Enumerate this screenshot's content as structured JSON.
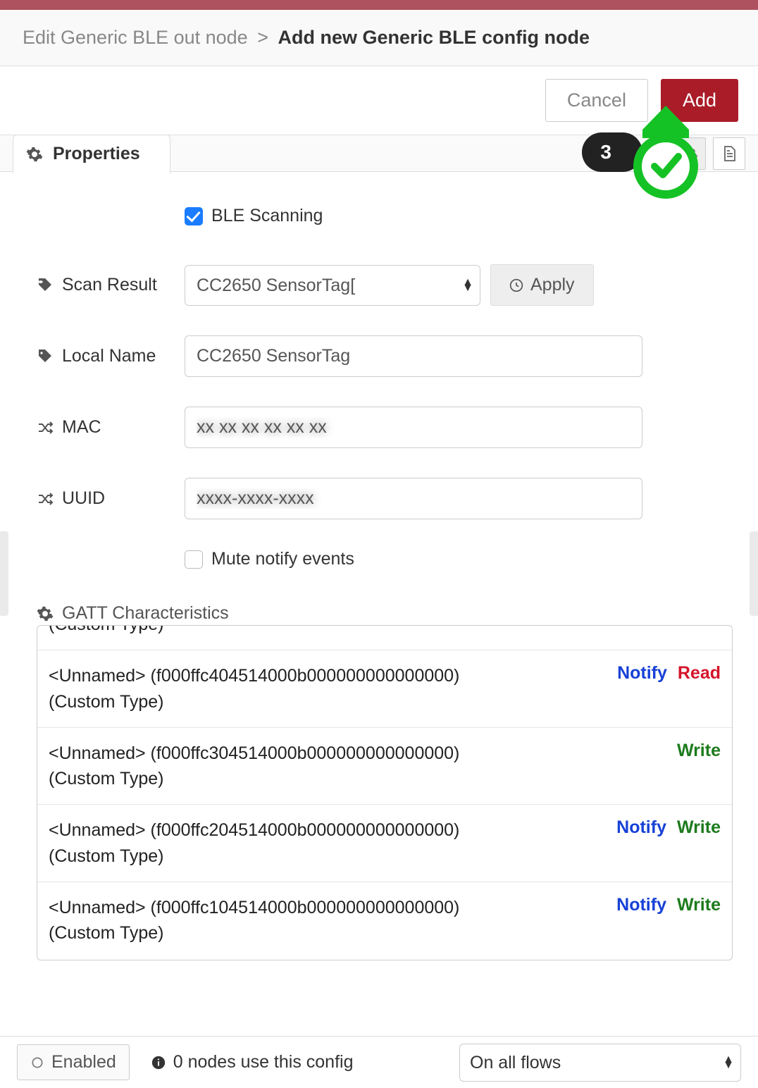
{
  "breadcrumb": {
    "parent": "Edit Generic BLE out node",
    "sep": ">",
    "current": "Add new Generic BLE config node"
  },
  "actions": {
    "cancel": "Cancel",
    "add": "Add"
  },
  "tabs": {
    "properties": "Properties"
  },
  "callout": {
    "step": "3"
  },
  "form": {
    "ble_scanning": {
      "label": "BLE Scanning",
      "checked": true
    },
    "scan_result": {
      "label": "Scan Result",
      "selected": "CC2650 SensorTag[",
      "apply": "Apply"
    },
    "local_name": {
      "label": "Local Name",
      "value": "CC2650 SensorTag"
    },
    "mac": {
      "label": "MAC",
      "value": ""
    },
    "uuid": {
      "label": "UUID",
      "value": ""
    },
    "mute": {
      "label": "Mute notify events",
      "checked": false
    },
    "gatt_title": "GATT Characteristics",
    "gatt": [
      {
        "line1": "(Custom Type)",
        "line2": "",
        "ops": []
      },
      {
        "line1": "<Unnamed>  (f000ffc404514000b000000000000000)",
        "line2": "(Custom Type)",
        "ops": [
          "Notify",
          "Read"
        ]
      },
      {
        "line1": "<Unnamed>  (f000ffc304514000b000000000000000)",
        "line2": "(Custom Type)",
        "ops": [
          "Write"
        ]
      },
      {
        "line1": "<Unnamed>  (f000ffc204514000b000000000000000)",
        "line2": "(Custom Type)",
        "ops": [
          "Notify",
          "Write"
        ]
      },
      {
        "line1": "<Unnamed>  (f000ffc104514000b000000000000000)",
        "line2": "(Custom Type)",
        "ops": [
          "Notify",
          "Write"
        ]
      }
    ]
  },
  "footer": {
    "enabled": "Enabled",
    "usage": "0 nodes use this config",
    "scope": "On all flows"
  },
  "op_labels": {
    "Notify": "Notify",
    "Read": "Read",
    "Write": "Write"
  }
}
